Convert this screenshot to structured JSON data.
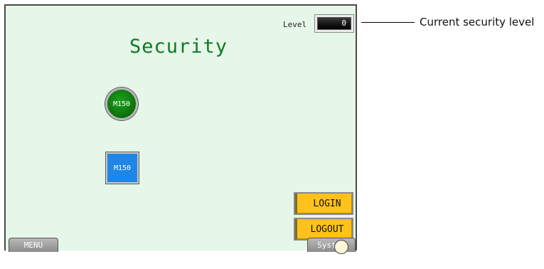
{
  "screen": {
    "title": "Security",
    "level_label": "Level",
    "level_value": "0"
  },
  "lamps": {
    "round_label": "M150",
    "square_label": "M150",
    "round_color": "#0b7d0b",
    "square_color": "#1f86e8"
  },
  "buttons": {
    "login": "LOGIN",
    "logout": "LOGOUT",
    "menu": "MENU",
    "system": "System"
  },
  "callout": {
    "text": "Current security level"
  },
  "colors": {
    "background": "#e6f6e8",
    "title": "#0a7a22",
    "login_buttons": "#ffc21a"
  }
}
